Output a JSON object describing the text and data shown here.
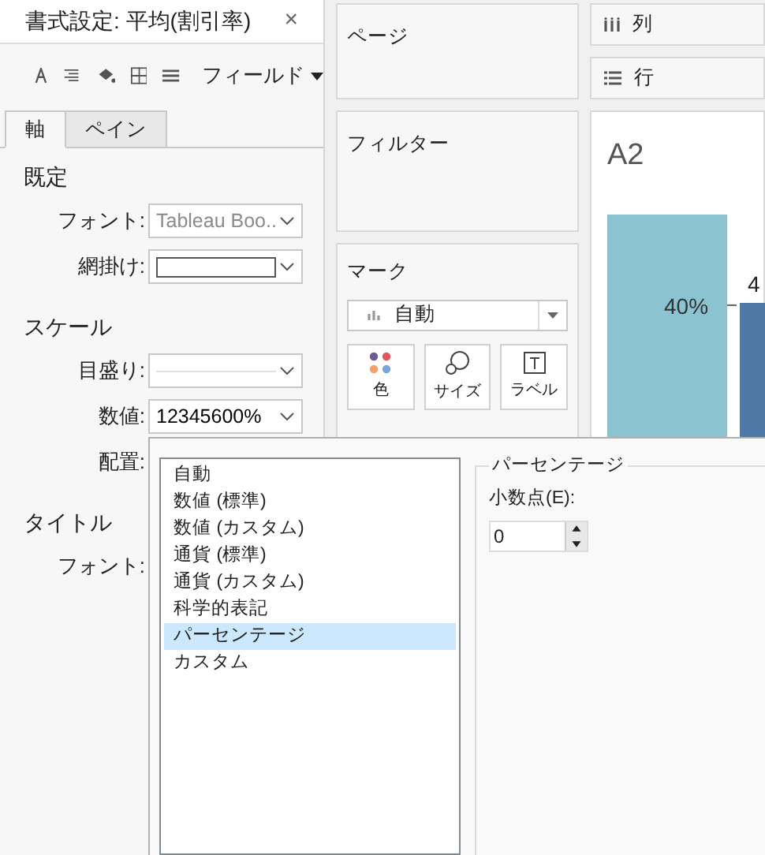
{
  "format_panel": {
    "title": "書式設定: 平均(割引率)",
    "close": "×",
    "field_menu": "フィールド",
    "tabs": [
      {
        "label": "軸",
        "selected": true
      },
      {
        "label": "ペイン",
        "selected": false
      }
    ],
    "sections": [
      {
        "heading": "既定",
        "rows": [
          {
            "label": "フォント:",
            "kind": "text",
            "value": "Tableau Boo..",
            "disabled": true
          },
          {
            "label": "網掛け:",
            "kind": "swatch"
          }
        ]
      },
      {
        "heading": "スケール",
        "rows": [
          {
            "label": "目盛り:",
            "kind": "line"
          },
          {
            "label": "数値:",
            "kind": "text",
            "value": "12345600%",
            "disabled": false
          },
          {
            "label": "配置:",
            "kind": "none"
          }
        ]
      },
      {
        "heading": "タイトル",
        "rows": [
          {
            "label": "フォント:",
            "kind": "none"
          }
        ]
      }
    ]
  },
  "shelves": {
    "pages": "ページ",
    "filters": "フィルター",
    "columns": "列",
    "rows": "行"
  },
  "marks": {
    "title": "マーク",
    "type": "自動",
    "buttons": [
      {
        "label": "色",
        "kind": "color"
      },
      {
        "label": "サイズ",
        "kind": "size"
      },
      {
        "label": "ラベル",
        "kind": "label"
      }
    ]
  },
  "view": {
    "title": "A2",
    "axis_label": "40%",
    "bar_label": "4"
  },
  "number_format": {
    "options": [
      {
        "label": "自動",
        "selected": false
      },
      {
        "label": "数値 (標準)",
        "selected": false
      },
      {
        "label": "数値 (カスタム)",
        "selected": false
      },
      {
        "label": "通貨 (標準)",
        "selected": false
      },
      {
        "label": "通貨 (カスタム)",
        "selected": false
      },
      {
        "label": "科学的表記",
        "selected": false
      },
      {
        "label": "パーセンテージ",
        "selected": true
      },
      {
        "label": "カスタム",
        "selected": false
      }
    ],
    "group_title": "パーセンテージ",
    "decimals_label": "小数点(E):",
    "decimals_value": "0"
  }
}
